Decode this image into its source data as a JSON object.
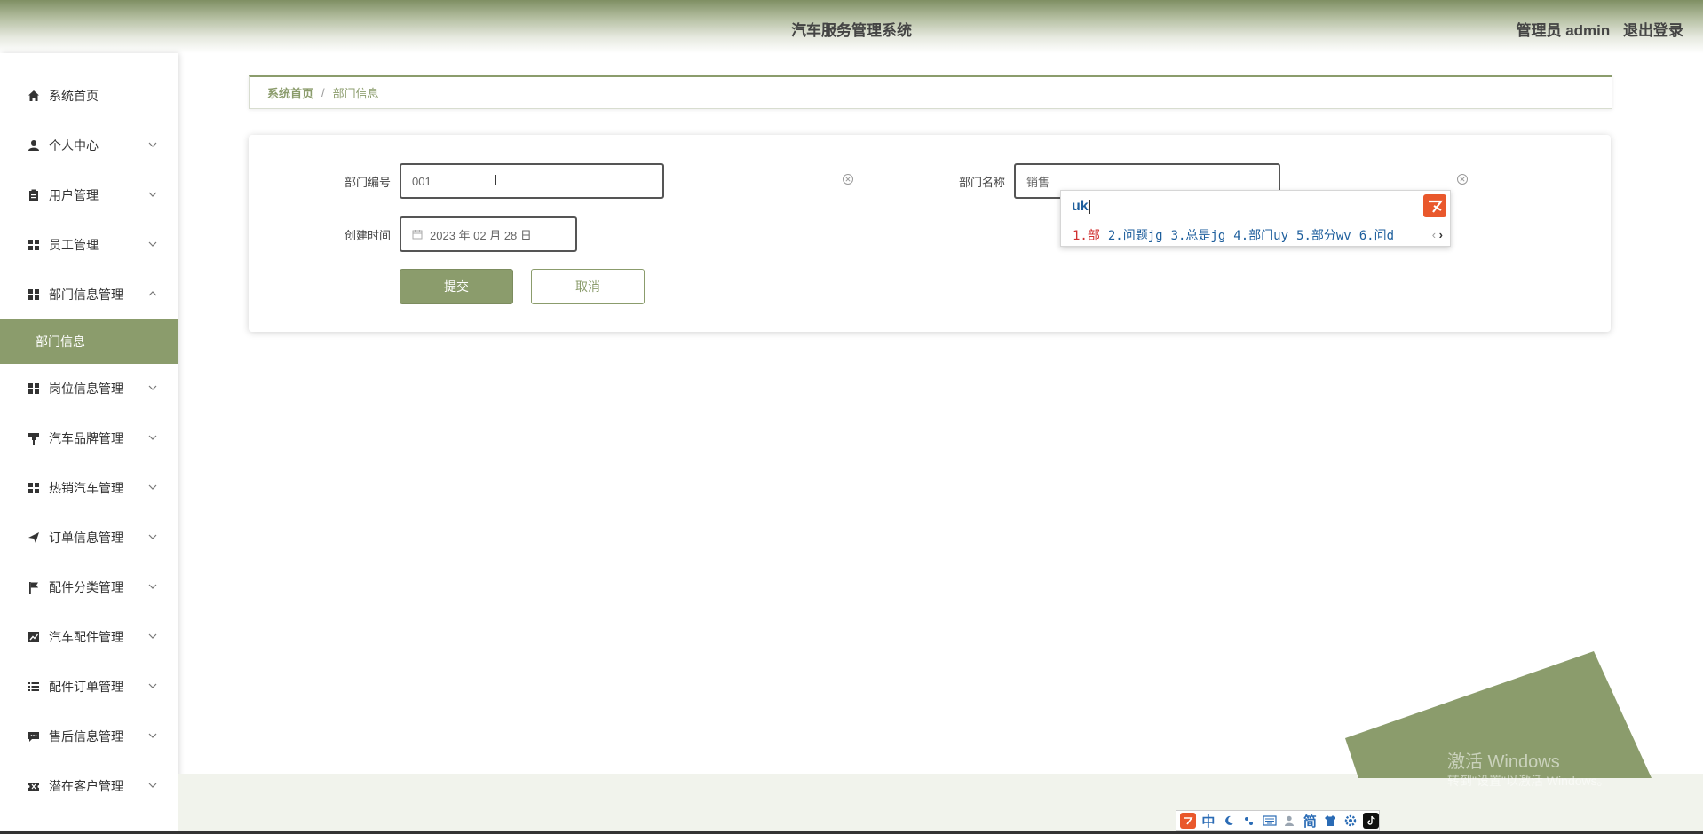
{
  "header": {
    "title": "汽车服务管理系统",
    "user_label": "管理员 admin",
    "logout_label": "退出登录"
  },
  "sidebar": {
    "items": [
      {
        "label": "系统首页",
        "icon": "home-icon"
      },
      {
        "label": "个人中心",
        "icon": "person-icon"
      },
      {
        "label": "用户管理",
        "icon": "clipboard-icon"
      },
      {
        "label": "员工管理",
        "icon": "grid-icon"
      },
      {
        "label": "部门信息管理",
        "icon": "grid-icon"
      },
      {
        "label": "岗位信息管理",
        "icon": "grid-icon"
      },
      {
        "label": "汽车品牌管理",
        "icon": "brush-icon"
      },
      {
        "label": "热销汽车管理",
        "icon": "grid-icon"
      },
      {
        "label": "订单信息管理",
        "icon": "send-icon"
      },
      {
        "label": "配件分类管理",
        "icon": "flag-icon"
      },
      {
        "label": "汽车配件管理",
        "icon": "chart-icon"
      },
      {
        "label": "配件订单管理",
        "icon": "list-icon"
      },
      {
        "label": "售后信息管理",
        "icon": "chat-icon"
      },
      {
        "label": "潜在客户管理",
        "icon": "ticket-icon"
      }
    ],
    "active_sub": "部门信息"
  },
  "breadcrumb": {
    "home": "系统首页",
    "separator": "/",
    "current": "部门信息"
  },
  "form": {
    "dept_no_label": "部门编号",
    "dept_no_value": "001",
    "dept_name_label": "部门名称",
    "dept_name_value": "销售",
    "created_label": "创建时间",
    "created_value": "2023 年 02 月 28 日",
    "submit_label": "提交",
    "cancel_label": "取消"
  },
  "ime": {
    "pinyin": "uk",
    "candidates": [
      "1.部",
      "2.问题jg",
      "3.总是jg",
      "4.部门uy",
      "5.部分wv",
      "6.问d"
    ]
  },
  "ime_bar": {
    "mode": "中",
    "simplified": "简"
  },
  "watermark": {
    "line1": "激活 Windows",
    "line2": "转到\"设置\"以激活 Windows。"
  },
  "colors": {
    "accent": "#8b9c6c",
    "header_dark": "#7f8f63"
  }
}
